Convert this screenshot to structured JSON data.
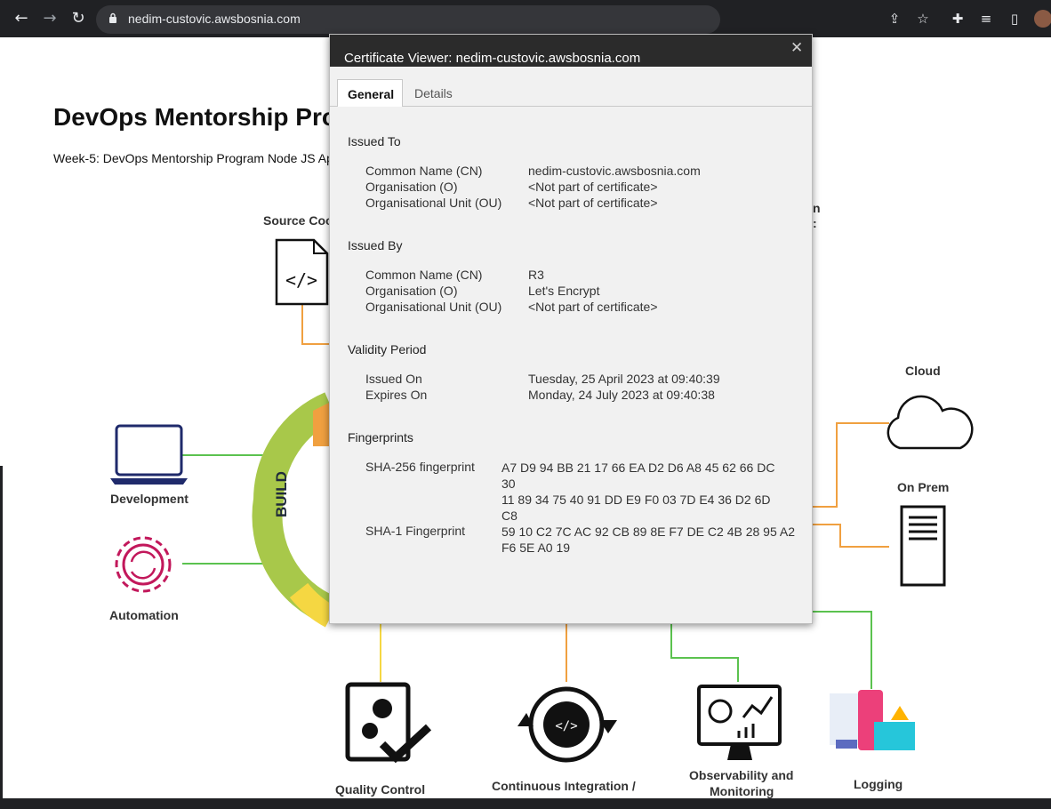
{
  "browser": {
    "url": "nedim-custovic.awsbosnia.com",
    "back_icon": "arrow-left",
    "forward_icon": "arrow-right",
    "reload_icon": "reload"
  },
  "page": {
    "title": "DevOps Mentorship Pro",
    "subtitle": "Week-5: DevOps Mentorship Program Node JS Ap",
    "diagram": {
      "source_code": "Source Coo",
      "build": "BUILD",
      "development": "Development",
      "automation": "Automation",
      "cloud": "Cloud",
      "on_prem": "On Prem",
      "quality_control": "Quality Control",
      "ci": "Continuous Integration /",
      "observability": "Observability and",
      "monitoring": "Monitoring",
      "logging": "Logging",
      "partial_right_1": "n",
      "partial_right_2": ":"
    }
  },
  "dialog": {
    "title": "Certificate Viewer: nedim-custovic.awsbosnia.com",
    "close": "✕",
    "tabs": [
      "General",
      "Details"
    ],
    "issued_to": {
      "heading": "Issued To",
      "rows": [
        {
          "label": "Common Name (CN)",
          "value": "nedim-custovic.awsbosnia.com"
        },
        {
          "label": "Organisation (O)",
          "value": "<Not part of certificate>"
        },
        {
          "label": "Organisational Unit (OU)",
          "value": "<Not part of certificate>"
        }
      ]
    },
    "issued_by": {
      "heading": "Issued By",
      "rows": [
        {
          "label": "Common Name (CN)",
          "value": "R3"
        },
        {
          "label": "Organisation (O)",
          "value": "Let's Encrypt"
        },
        {
          "label": "Organisational Unit (OU)",
          "value": "<Not part of certificate>"
        }
      ]
    },
    "validity": {
      "heading": "Validity Period",
      "rows": [
        {
          "label": "Issued On",
          "value": "Tuesday, 25 April 2023 at 09:40:39"
        },
        {
          "label": "Expires On",
          "value": "Monday, 24 July 2023 at 09:40:38"
        }
      ]
    },
    "fingerprints": {
      "heading": "Fingerprints",
      "sha256_label": "SHA-256 fingerprint",
      "sha256_lines": [
        "A7 D9 94 BB 21 17 66 EA D2 D6 A8 45 62 66 DC",
        "30",
        "11 89 34 75 40 91 DD E9 F0 03 7D E4 36 D2 6D",
        "C8"
      ],
      "sha1_label": "SHA-1 Fingerprint",
      "sha1_lines": [
        "59 10 C2 7C AC 92 CB 89 8E F7 DE C2 4B 28 95 A2",
        "F6 5E A0 19"
      ]
    }
  }
}
